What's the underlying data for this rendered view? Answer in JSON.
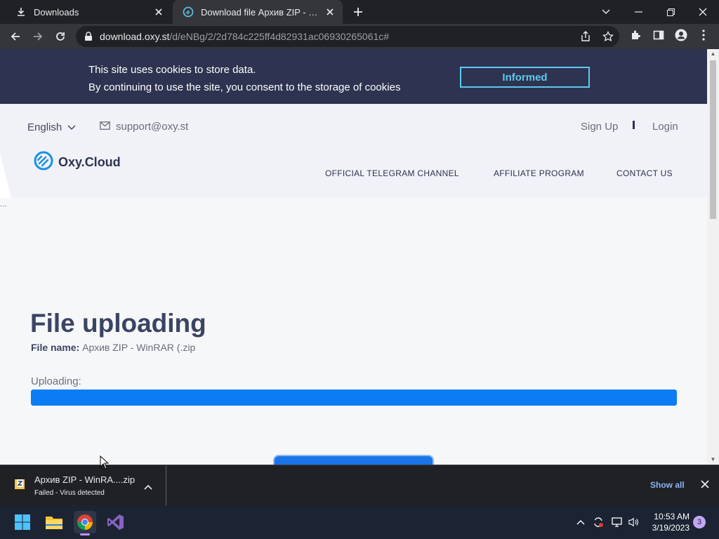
{
  "browser": {
    "tabs": [
      {
        "title": "Downloads",
        "icon": "download-icon",
        "active": false
      },
      {
        "title": "Download file Архив ZIP - WinRAR (.zip)",
        "icon": "oxy-cloud-favicon",
        "active": true
      }
    ],
    "url": {
      "host": "download.oxy.st",
      "path": "/d/eNBg/2/2d784c225ff4d82931ac06930265061c#"
    }
  },
  "cookie_banner": {
    "line1": "This site uses cookies to store data.",
    "line2": "By continuing to use the site, you consent to the storage of cookies",
    "button": "Informed"
  },
  "header": {
    "language": "English",
    "email": "support@oxy.st",
    "sign_up": "Sign Up",
    "login": "Login",
    "logo_text": "Oxy.Cloud",
    "nav": [
      "OFFICIAL TELEGRAM CHANNEL",
      "AFFILIATE PROGRAM",
      "CONTACT US"
    ]
  },
  "content": {
    "title": "File uploading",
    "file_name_label": "File name:",
    "file_name": "Архив ZIP - WinRAR (.zip",
    "uploading_label": "Uploading:",
    "progress_percent": 100
  },
  "download_shelf": {
    "file_name": "Архив ZIP - WinRA....zip",
    "status": "Failed - Virus detected",
    "show_all": "Show all"
  },
  "taskbar": {
    "time": "10:53 AM",
    "date": "3/19/2023",
    "notifications": "3"
  },
  "colors": {
    "cookie_bg": "#2d3350",
    "accent_cyan": "#5ec8ef",
    "progress_blue": "#0c7cf4",
    "title_text": "#3c4464"
  }
}
